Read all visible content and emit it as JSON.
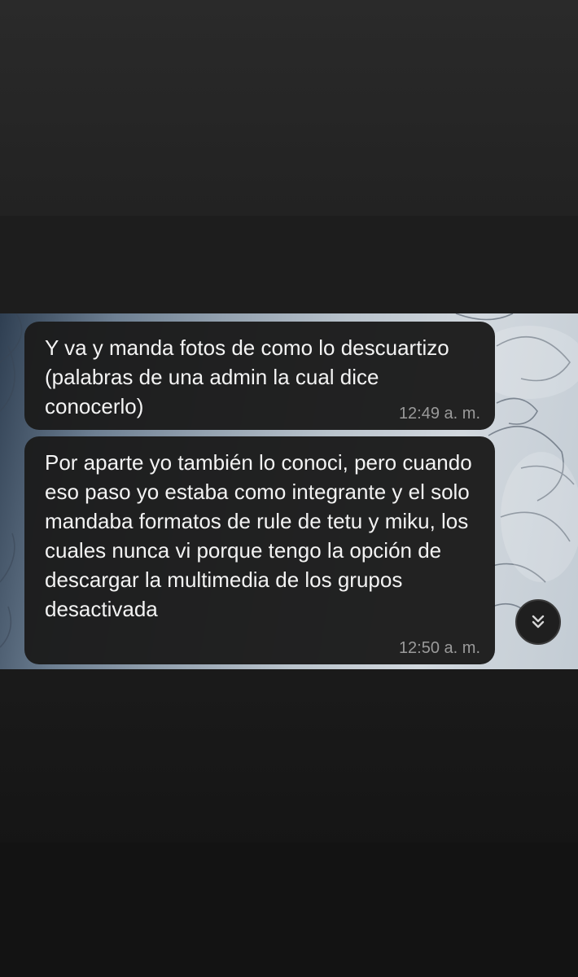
{
  "chat": {
    "messages": [
      {
        "text": "Y va y manda fotos de como lo descuartizo (palabras de una admin la cual dice conocerlo)",
        "time": "12:49 a. m."
      },
      {
        "text": "Por aparte yo también lo conoci, pero cuando eso paso yo estaba como integrante y el solo mandaba formatos de rule de tetu y miku, los cuales nunca vi porque tengo la opción de descargar la multimedia de los grupos desactivada",
        "time": "12:50 a. m."
      }
    ],
    "scroll_button_icon": "double-chevron-down-icon",
    "colors": {
      "bubble": "#1c1c1c",
      "text": "#f3f3f3",
      "timestamp": "#9a9a9a",
      "background": "#1e1e1e"
    }
  }
}
